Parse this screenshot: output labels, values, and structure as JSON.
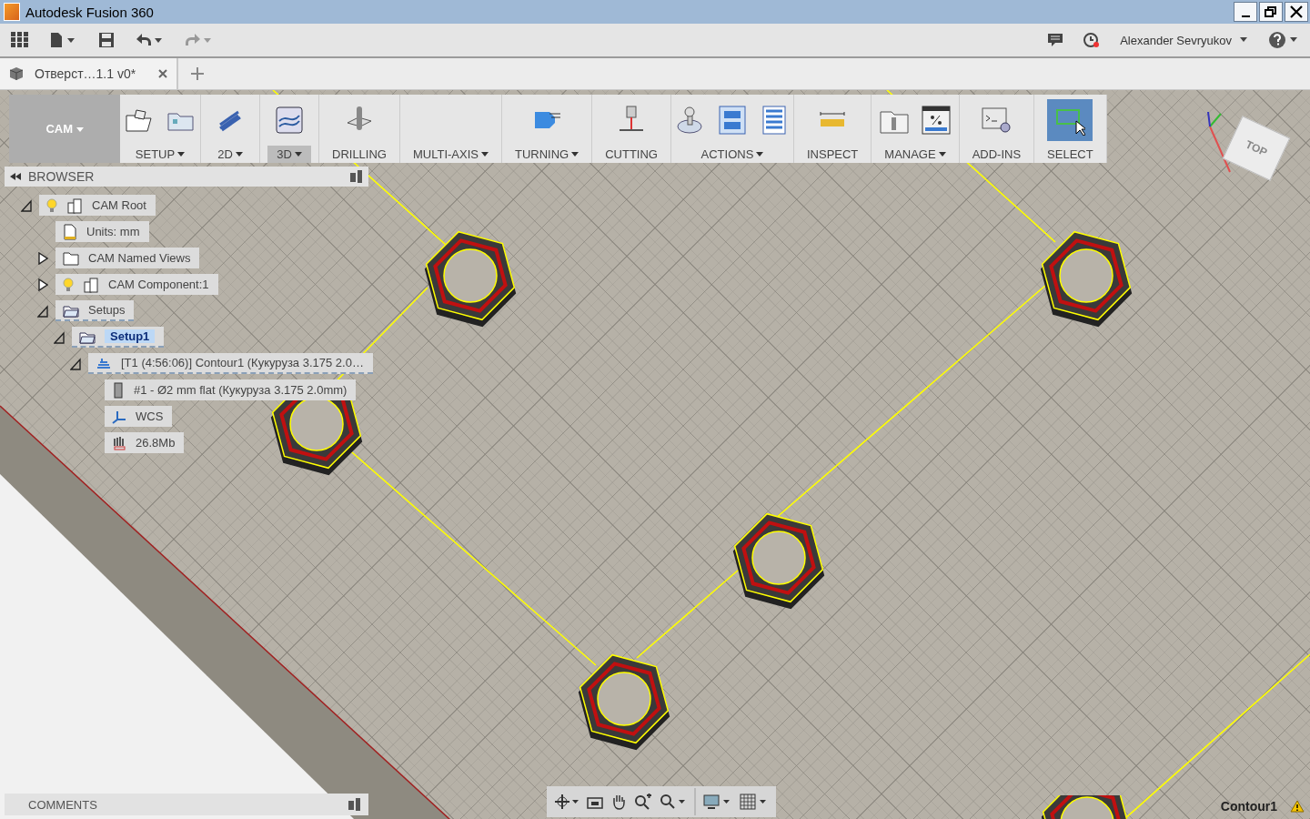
{
  "window": {
    "title": "Autodesk Fusion 360"
  },
  "user": {
    "name": "Alexander Sevryukov"
  },
  "tabs": [
    {
      "label": "Отверст…1.1 v0*",
      "selected": true
    }
  ],
  "workspace": {
    "label": "CAM"
  },
  "toolbar": [
    {
      "label": "SETUP",
      "dropdown": true,
      "selected": false
    },
    {
      "label": "2D",
      "dropdown": true,
      "selected": false
    },
    {
      "label": "3D",
      "dropdown": true,
      "selected": true
    },
    {
      "label": "DRILLING",
      "dropdown": false,
      "selected": false
    },
    {
      "label": "MULTI-AXIS",
      "dropdown": true,
      "selected": false
    },
    {
      "label": "TURNING",
      "dropdown": true,
      "selected": false
    },
    {
      "label": "CUTTING",
      "dropdown": false,
      "selected": false
    },
    {
      "label": "ACTIONS",
      "dropdown": true,
      "selected": false
    },
    {
      "label": "INSPECT",
      "dropdown": false,
      "selected": false
    },
    {
      "label": "MANAGE",
      "dropdown": true,
      "selected": false
    },
    {
      "label": "ADD-INS",
      "dropdown": false,
      "selected": false
    },
    {
      "label": "SELECT",
      "dropdown": false,
      "selected": false
    }
  ],
  "viewcube": {
    "face": "TOP"
  },
  "browser": {
    "title": "BROWSER",
    "tree": [
      {
        "label": "CAM Root",
        "kind": "component",
        "light_on": true,
        "expanded": true,
        "selected": false,
        "children": [
          {
            "label": "Units: mm",
            "kind": "units",
            "selected": false
          },
          {
            "label": "CAM Named Views",
            "kind": "folder",
            "expanded": false,
            "selected": false
          },
          {
            "label": "CAM Component:1",
            "kind": "component",
            "light_on": true,
            "expanded": false,
            "selected": false
          },
          {
            "label": "Setups",
            "kind": "setup",
            "expanded": true,
            "selected": false,
            "children": [
              {
                "label": "Setup1",
                "kind": "setup",
                "expanded": true,
                "selected": true,
                "children": [
                  {
                    "label": "[T1 (4:56:06)] Contour1 (Кукуруза 3.175 2.0…",
                    "kind": "operation",
                    "expanded": true,
                    "selected": false,
                    "children": [
                      {
                        "label": "#1 - Ø2 mm flat (Кукуруза 3.175 2.0mm)",
                        "kind": "tool",
                        "selected": false
                      },
                      {
                        "label": "WCS",
                        "kind": "wcs",
                        "selected": false
                      },
                      {
                        "label": "26.8Mb",
                        "kind": "memory",
                        "selected": false
                      }
                    ]
                  }
                ]
              }
            ]
          }
        ]
      }
    ]
  },
  "comments": {
    "title": "COMMENTS"
  },
  "status_bar": {
    "text": "Contour1"
  }
}
